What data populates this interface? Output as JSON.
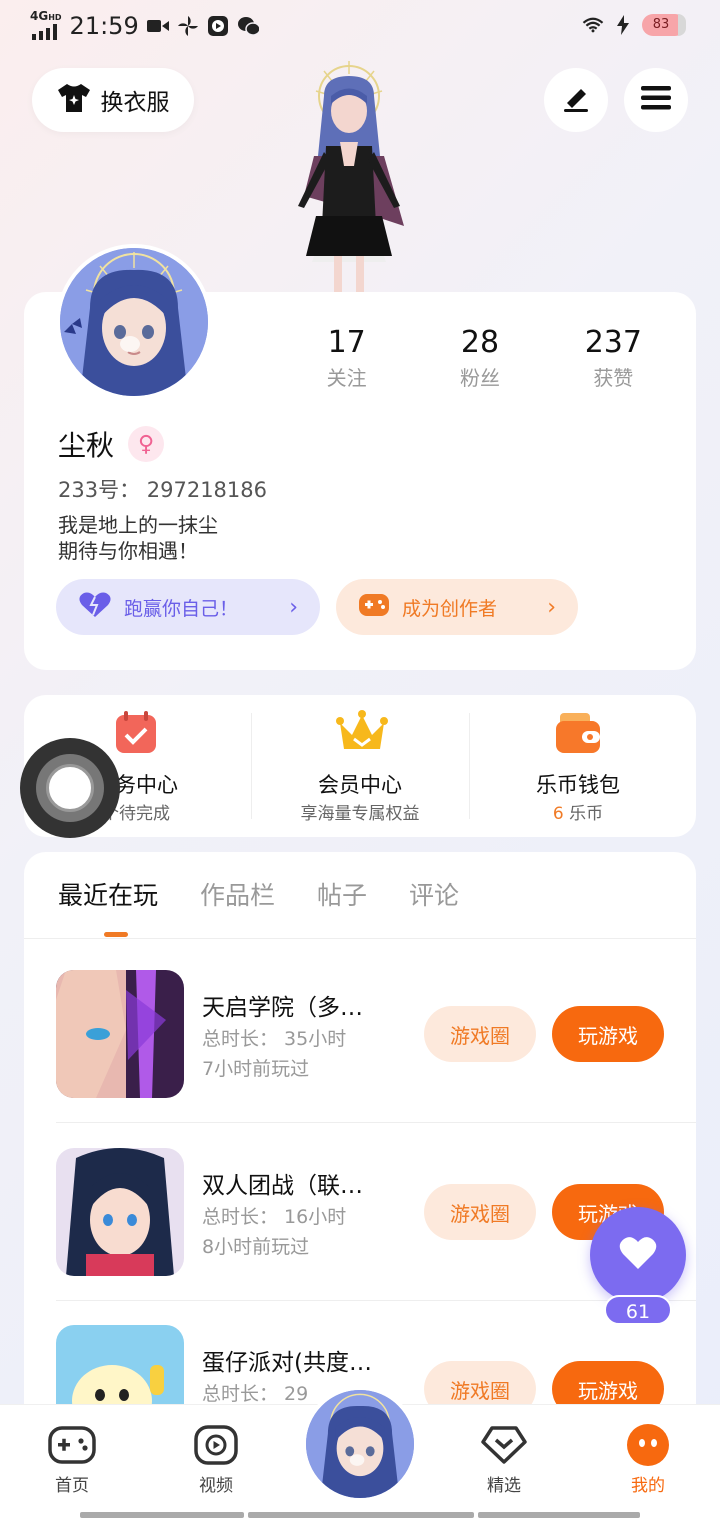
{
  "status": {
    "network": "4G",
    "network_sup": "HD",
    "time": "21:59",
    "battery": "83"
  },
  "header": {
    "outfit_label": "换衣服",
    "edit_icon": "pencil-icon",
    "menu_icon": "hamburger-icon"
  },
  "profile": {
    "stats": [
      {
        "num": "17",
        "label": "关注"
      },
      {
        "num": "28",
        "label": "粉丝"
      },
      {
        "num": "237",
        "label": "获赞"
      }
    ],
    "name": "尘秋",
    "gender_symbol": "♀",
    "uid": "233号： 297218186",
    "bio": "我是地上的一抹尘\n期待与你相遇！",
    "run_label": "跑赢你自己！",
    "creator_label": "成为创作者",
    "chevron": "›"
  },
  "services": {
    "task_title": "任务中心",
    "task_sub": "个待完成",
    "member_title": "会员中心",
    "member_sub": "享海量专属权益",
    "wallet_title": "乐币钱包",
    "wallet_amount": "6",
    "wallet_unit": " 乐币"
  },
  "tabs": [
    "最近在玩",
    "作品栏",
    "帖子",
    "评论"
  ],
  "games": [
    {
      "title": "天启学院（多…",
      "duration": "总时长： 35小时",
      "last": "7小时前玩过",
      "circle": "游戏圈",
      "play": "玩游戏"
    },
    {
      "title": "双人团战（联…",
      "duration": "总时长： 16小时",
      "last": "8小时前玩过",
      "circle": "游戏圈",
      "play": "玩游戏"
    },
    {
      "title": "蛋仔派对(共度…",
      "duration": "总时长： 29",
      "last": "",
      "circle": "游戏圈",
      "play": "玩游戏"
    }
  ],
  "like_count": "61",
  "nav": [
    {
      "label": "首页",
      "icon": "gamepad-icon"
    },
    {
      "label": "视频",
      "icon": "play-icon"
    },
    {
      "label": "精选",
      "icon": "heart-diamond-icon"
    },
    {
      "label": "我的",
      "icon": "face-icon"
    }
  ],
  "colors": {
    "accent": "#f7690f",
    "purple": "#7c6bf0"
  }
}
